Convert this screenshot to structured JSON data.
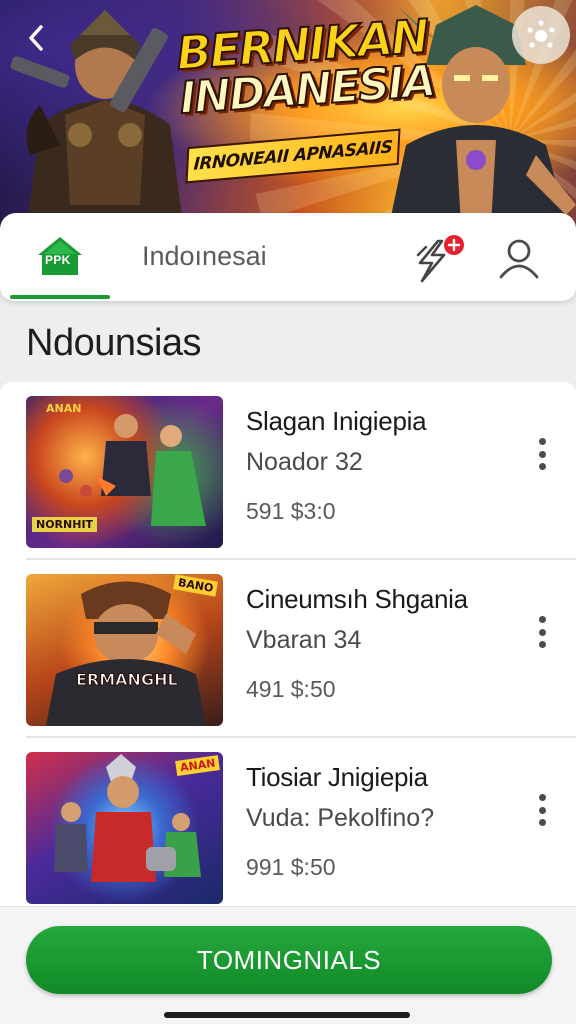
{
  "hero": {
    "title_line1": "BERNIKAN",
    "title_line2": "INDANESIA",
    "subtitle": "IRNONEAII APNASAIIS"
  },
  "tabs": {
    "home_icon_label": "PPK",
    "active_label": "Indoınesai"
  },
  "section": {
    "title": "Ndounsias"
  },
  "items": [
    {
      "name": "Slagan Inigiepia",
      "sub": "Noador 32",
      "price": "591 $3:0",
      "thumb_tag": "NORNHIT",
      "thumb_corner": "ANAN"
    },
    {
      "name": "Cineumsıh Shgania",
      "sub": "Vbaran 34",
      "price": "491 $:50",
      "thumb_tag": "ERMANGHL",
      "thumb_corner": "BANO"
    },
    {
      "name": "Tiosiar Jnigiepia",
      "sub": "Vuda: Pekolfino?",
      "price": "991 $:50",
      "thumb_tag": "",
      "thumb_corner": "ANAN"
    }
  ],
  "cta": {
    "label": "TOMINGNIALS"
  },
  "colors": {
    "accent_green": "#1a9a34",
    "badge_red": "#e8202e"
  },
  "icons": [
    "back-icon",
    "more-options-icon",
    "home-icon",
    "lightning-notification-icon",
    "profile-icon",
    "kebab-menu-icon"
  ]
}
